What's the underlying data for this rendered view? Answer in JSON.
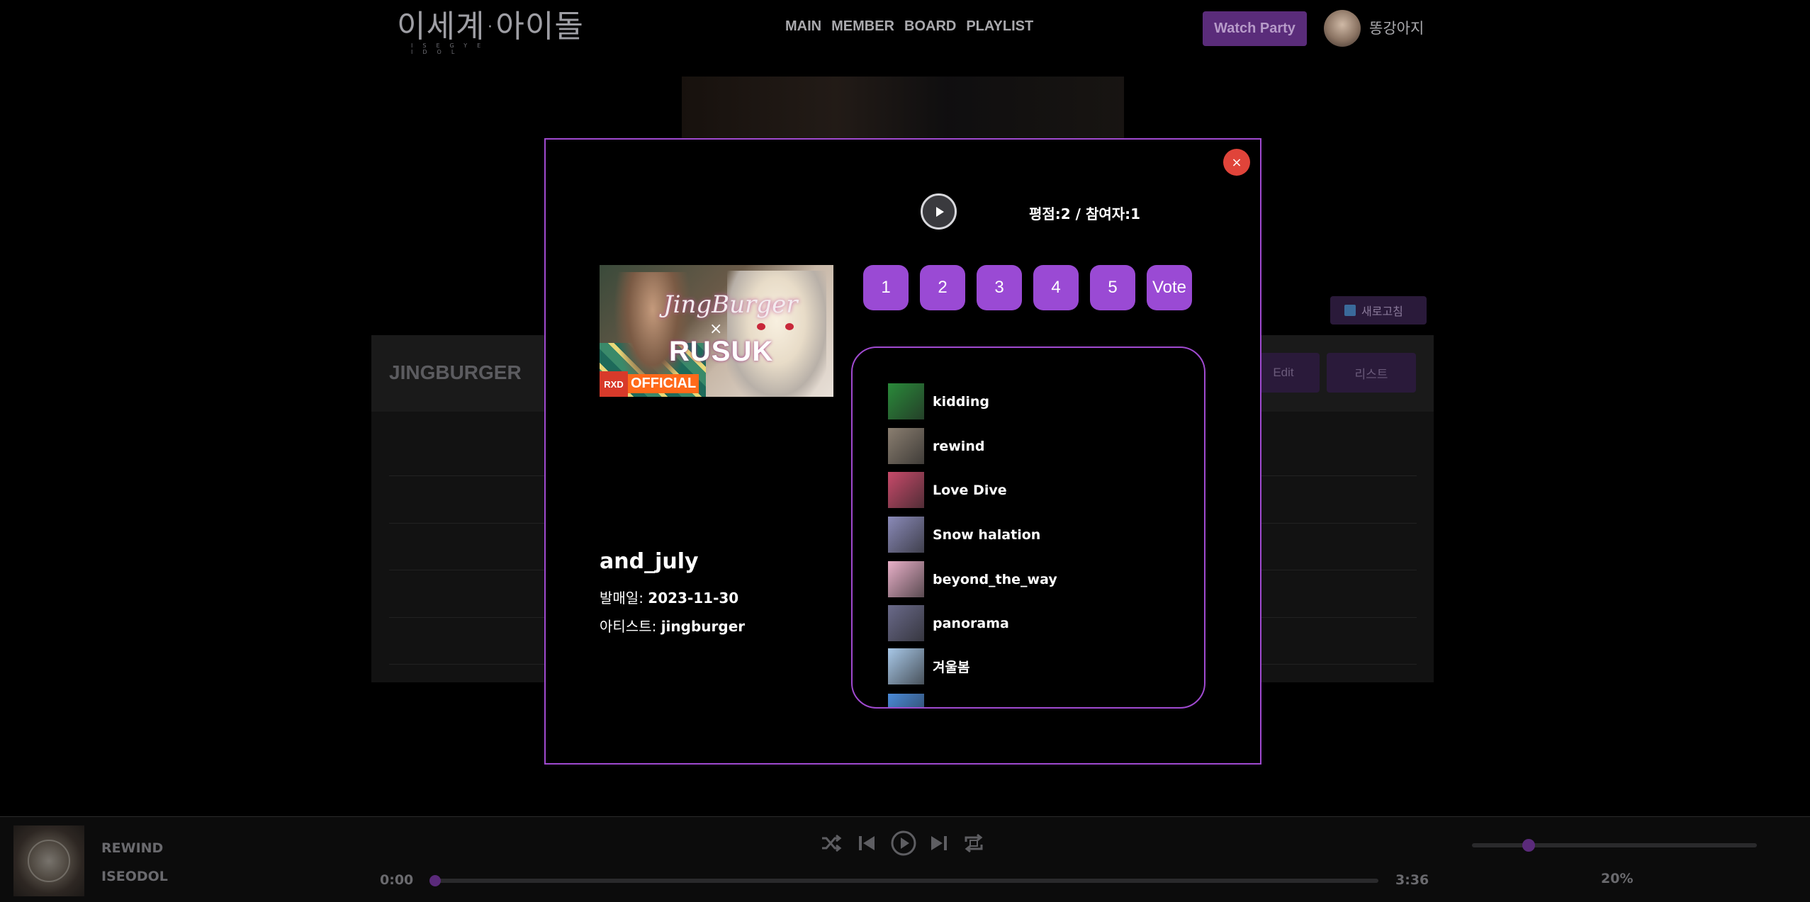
{
  "header": {
    "logo_text": "이세계·아이돌",
    "logo_sub": "ISEGYE IDOL",
    "nav": [
      "MAIN",
      "MEMBER",
      "BOARD",
      "PLAYLIST"
    ],
    "watch_party": "Watch Party",
    "username": "똥강아지"
  },
  "background": {
    "refresh_label": "새로고침",
    "panel_title": "JINGBURGER",
    "edit_label": "Edit",
    "list_label": "리스트"
  },
  "modal": {
    "close_glyph": "×",
    "rating_text": "평점:2 / 참여자:1",
    "cover": {
      "script_title": "JingBurger",
      "x_mark": "×",
      "main_title": "RUSUK",
      "badge_mark": "RXD",
      "badge_text": "OFFICIAL"
    },
    "song_title": "and_july",
    "release_label": "발매일: ",
    "release_date": "2023-11-30",
    "artist_label": "아티스트: ",
    "artist": "jingburger",
    "vote_buttons": [
      "1",
      "2",
      "3",
      "4",
      "5",
      "Vote"
    ],
    "playlist": [
      {
        "title": "kidding",
        "thumb": "#2a8a3a"
      },
      {
        "title": "rewind",
        "thumb": "#8a7e70"
      },
      {
        "title": "Love Dive",
        "thumb": "#c84a6a"
      },
      {
        "title": "Snow halation",
        "thumb": "#8a8ab8"
      },
      {
        "title": "beyond_the_way",
        "thumb": "#e8b0c8"
      },
      {
        "title": "panorama",
        "thumb": "#6a6a8a"
      },
      {
        "title": "겨울봄",
        "thumb": "#a8c8e8"
      },
      {
        "title": "",
        "thumb": "#4a8ad8"
      }
    ]
  },
  "player": {
    "title": "REWIND",
    "artist": "ISEODOL",
    "time_current": "0:00",
    "time_total": "3:36",
    "progress": 0.0,
    "volume_label": "20%",
    "volume": 0.2
  },
  "colors": {
    "accent": "#9a4ad4",
    "modal_border": "#a04ad0",
    "close": "#e0443a"
  }
}
